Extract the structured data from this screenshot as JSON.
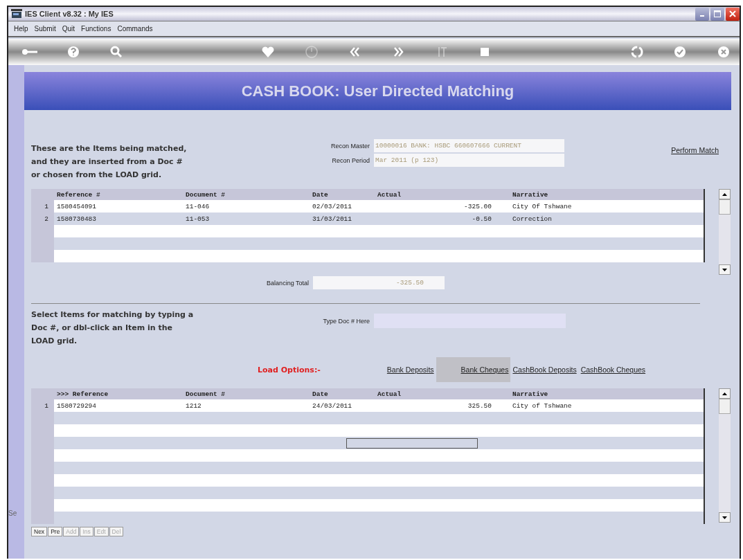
{
  "window": {
    "title": "IES Client v8.32 : My IES"
  },
  "menu": [
    "Help",
    "Submit",
    "Quit",
    "Functions",
    "Commands"
  ],
  "toolbar": [
    {
      "kind": "key",
      "disabled": false
    },
    {
      "kind": "help",
      "disabled": false
    },
    {
      "kind": "search",
      "disabled": false
    },
    {
      "kind": "spacer"
    },
    {
      "kind": "heart",
      "disabled": false
    },
    {
      "kind": "clock",
      "disabled": true
    },
    {
      "kind": "rewind",
      "disabled": false
    },
    {
      "kind": "forward",
      "disabled": false
    },
    {
      "kind": "column",
      "disabled": true
    },
    {
      "kind": "square",
      "disabled": false
    },
    {
      "kind": "spacer"
    },
    {
      "kind": "recycle",
      "disabled": false
    },
    {
      "kind": "check",
      "disabled": false
    },
    {
      "kind": "cancel",
      "disabled": false
    }
  ],
  "side_text": "Se",
  "header": "CASH BOOK: User Directed Matching",
  "intro": [
    "These are the Items being matched,",
    "and they are inserted from a Doc #",
    "or chosen from the LOAD grid."
  ],
  "recon_master": {
    "label": "Recon Master",
    "value": "10000016 BANK: HSBC 660607666 CURRENT"
  },
  "recon_period": {
    "label": "Recon Period",
    "value": "Mar 2011 (p 123)"
  },
  "perform_match": "Perform Match",
  "columns": [
    "Reference #",
    "Document #",
    "Date",
    "Actual",
    "Narrative"
  ],
  "match_grid": {
    "rows": [
      {
        "number": "1",
        "cells": [
          "1580454091",
          "11-046",
          "02/03/2011",
          "-325.00",
          "City Of Tshwane"
        ],
        "editing": false
      },
      {
        "number": "2",
        "cells": [
          "1580730483",
          "11-053",
          "31/03/2011",
          "-0.50",
          "Correction"
        ],
        "editing": false
      },
      {
        "editing": false
      },
      {
        "editing": false
      },
      {
        "editing": false
      }
    ]
  },
  "balancing_total": {
    "label": "Balancing Total",
    "value": "-325.50"
  },
  "select_text": [
    "Select Items for matching by typing a",
    "Doc #, or dbl-click an Item in the",
    "LOAD grid."
  ],
  "doc_field": {
    "label": "Type Doc # Here"
  },
  "load_options": {
    "label": "Load Options:-",
    "tabs": [
      {
        "label": "Bank Deposits",
        "selected": false
      },
      {
        "label": "Bank Cheques",
        "selected": true
      },
      {
        "label": "CashBook Deposits",
        "selected": false
      },
      {
        "label": "CashBook Cheques",
        "selected": false
      }
    ]
  },
  "load_grid": {
    "columns": [
      ">>> Reference",
      "Document #",
      "Date",
      "Actual",
      "Narrative"
    ],
    "rows": [
      {
        "number": "1",
        "cells": [
          "1580729294",
          "1212",
          "24/03/2011",
          "325.50",
          "City of Tshwane"
        ],
        "editing": false
      },
      {
        "editing": false
      },
      {
        "editing": false
      },
      {
        "editing": true
      },
      {
        "editing": false
      },
      {
        "editing": false
      },
      {
        "editing": false
      },
      {
        "editing": false
      },
      {
        "editing": false
      },
      {
        "editing": false
      }
    ]
  },
  "nav_buttons": [
    {
      "label": "Nex",
      "disabled": false
    },
    {
      "label": "Pre",
      "disabled": false
    },
    {
      "label": "Add",
      "disabled": true
    },
    {
      "label": "Ins",
      "disabled": true
    },
    {
      "label": "Edt",
      "disabled": true
    },
    {
      "label": "Del",
      "disabled": true
    }
  ]
}
